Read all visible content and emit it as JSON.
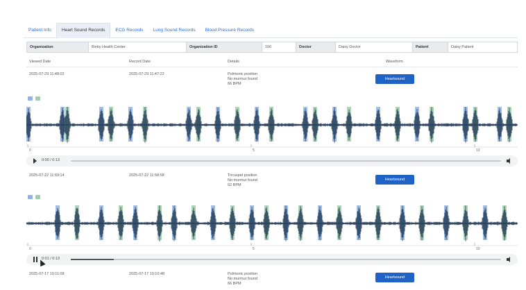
{
  "tabs": [
    {
      "label": "Patient Info",
      "active": false
    },
    {
      "label": "Heart Sound Records",
      "active": true
    },
    {
      "label": "ECG Records",
      "active": false
    },
    {
      "label": "Lung Sound Records",
      "active": false
    },
    {
      "label": "Blood Pressure Records",
      "active": false
    }
  ],
  "info": {
    "organization_label": "Organization",
    "organization_value": "Bixby Health Center",
    "organization_id_label": "Organization ID",
    "organization_id_value": "166",
    "doctor_label": "Doctor",
    "doctor_value": "Daisy Doctor",
    "patient_label": "Patient",
    "patient_value": "Daisy Patient"
  },
  "columns": {
    "viewed": "Viewed Date",
    "record": "Record Date",
    "details": "Details",
    "waveform": "Waveform"
  },
  "records": [
    {
      "viewed": "2025-07-29 11:48:02",
      "record": "2025-07-29 11:47:22",
      "details": [
        "Pulmonic position",
        "No murmur found",
        "66 BPM"
      ],
      "button": "Heartsound",
      "audio_time": "0:00 / 0:13",
      "playing": false,
      "progress": 0
    },
    {
      "viewed": "2025-07-22 11:59:14",
      "record": "2025-07-22 11:58:58",
      "details": [
        "Tricuspid position",
        "No murmur found",
        "62 BPM"
      ],
      "button": "Heartsound",
      "audio_time": "0:01 / 0:13",
      "playing": true,
      "progress": 0.1
    },
    {
      "viewed": "2025-07-17 10:11:08",
      "record": "2025-07-17 10:10:48",
      "details": [
        "Pulmonic position",
        "No murmur found",
        "66 BPM"
      ],
      "button": "Heartsound"
    }
  ],
  "legend_colors": {
    "s1": "#8fb3e4",
    "s2": "#9fcfaa"
  },
  "wave_color": "#1c3550",
  "time_marks": [
    "0",
    "5",
    "10"
  ],
  "wave1": {
    "blue_marks": [
      0.0,
      0.07,
      0.15,
      0.21,
      0.33,
      0.39,
      0.47,
      0.57,
      0.63,
      0.72,
      0.8,
      0.9,
      0.97
    ],
    "green_marks": [
      0.08,
      0.17,
      0.24,
      0.35,
      0.43,
      0.5,
      0.59,
      0.66,
      0.76,
      0.83,
      0.92,
      0.99
    ]
  },
  "wave2": {
    "blue_marks": [
      0.06,
      0.15,
      0.22,
      0.3,
      0.38,
      0.46,
      0.53,
      0.6,
      0.68,
      0.77,
      0.86,
      0.94
    ],
    "green_marks": [
      0.1,
      0.19,
      0.27,
      0.34,
      0.42,
      0.49,
      0.56,
      0.64,
      0.72,
      0.81,
      0.9,
      0.98
    ]
  }
}
